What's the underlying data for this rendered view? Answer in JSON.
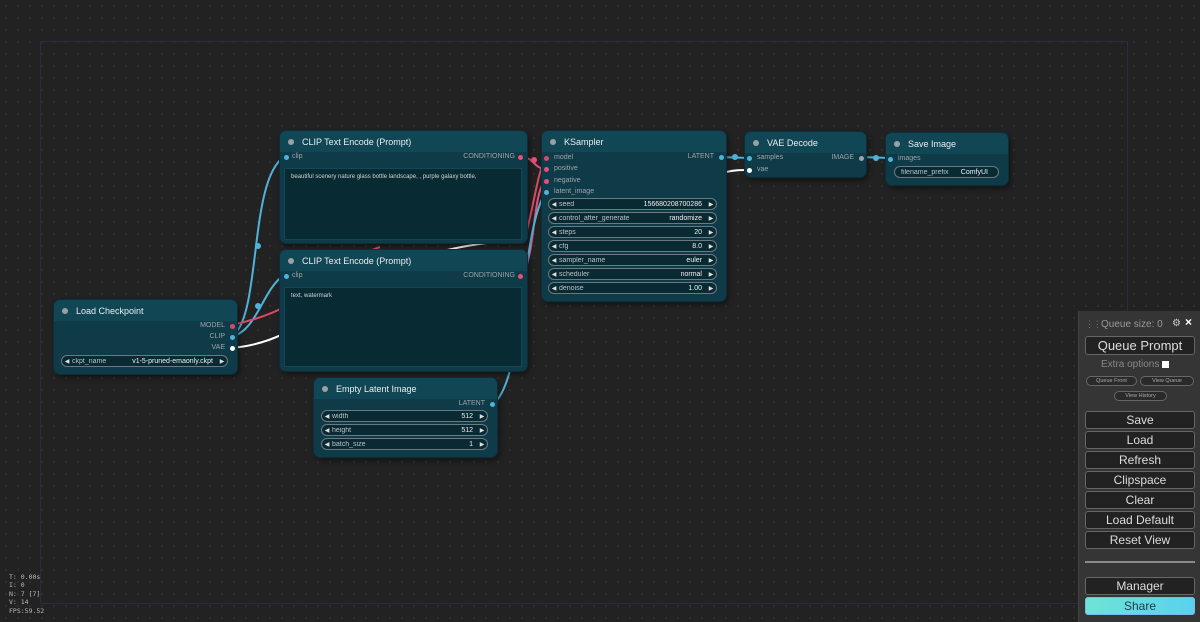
{
  "stats": {
    "t": "T: 0.00s",
    "i": "I: 0",
    "n": "N: 7 [7]",
    "v": "V: 14",
    "fps": "FPS:59.52"
  },
  "nodes": {
    "clip_pos": {
      "title": "CLIP Text Encode (Prompt)",
      "input_clip": "clip",
      "output_conditioning": "CONDITIONING",
      "text": "beautiful scenery nature glass bottle landscape, , purple galaxy bottle,"
    },
    "clip_neg": {
      "title": "CLIP Text Encode (Prompt)",
      "input_clip": "clip",
      "output_conditioning": "CONDITIONING",
      "text": "text, watermark"
    },
    "ksampler": {
      "title": "KSampler",
      "inputs": [
        "model",
        "positive",
        "negative",
        "latent_image"
      ],
      "output_latent": "LATENT",
      "widgets": [
        {
          "label": "seed",
          "value": "156680208700286"
        },
        {
          "label": "control_after_generate",
          "value": "randomize"
        },
        {
          "label": "steps",
          "value": "20"
        },
        {
          "label": "cfg",
          "value": "8.0"
        },
        {
          "label": "sampler_name",
          "value": "euler"
        },
        {
          "label": "scheduler",
          "value": "normal"
        },
        {
          "label": "denoise",
          "value": "1.00"
        }
      ]
    },
    "vae_decode": {
      "title": "VAE Decode",
      "input_samples": "samples",
      "input_vae": "vae",
      "output_image": "IMAGE"
    },
    "save_image": {
      "title": "Save Image",
      "input_images": "images",
      "widget_label": "filename_prefix",
      "widget_value": "ComfyUI"
    },
    "load_checkpoint": {
      "title": "Load Checkpoint",
      "output_model": "MODEL",
      "output_clip": "CLIP",
      "output_vae": "VAE",
      "widget_label": "ckpt_name",
      "widget_value": "v1-5-pruned-emaonly.ckpt"
    },
    "empty_latent": {
      "title": "Empty Latent Image",
      "output_latent": "LATENT",
      "widgets": [
        {
          "label": "width",
          "value": "512"
        },
        {
          "label": "height",
          "value": "512"
        },
        {
          "label": "batch_size",
          "value": "1"
        }
      ]
    }
  },
  "menu": {
    "queue_size": "Queue size: 0",
    "queue_prompt": "Queue Prompt",
    "extra_options": "Extra options",
    "queue_front": "Queue Front",
    "view_queue": "View Queue",
    "view_history": "View History",
    "save": "Save",
    "load": "Load",
    "refresh": "Refresh",
    "clipspace": "Clipspace",
    "clear": "Clear",
    "load_default": "Load Default",
    "reset_view": "Reset View",
    "manager": "Manager",
    "share": "Share"
  },
  "colors": {
    "clip_link": "#4fb3d9",
    "model_link": "#d94a6a",
    "conditioning_link": "#e8507a",
    "latent_link": "#d94a90",
    "vae_link": "#ffffff",
    "node_body": "#0f3a47",
    "node_title": "#114655"
  }
}
